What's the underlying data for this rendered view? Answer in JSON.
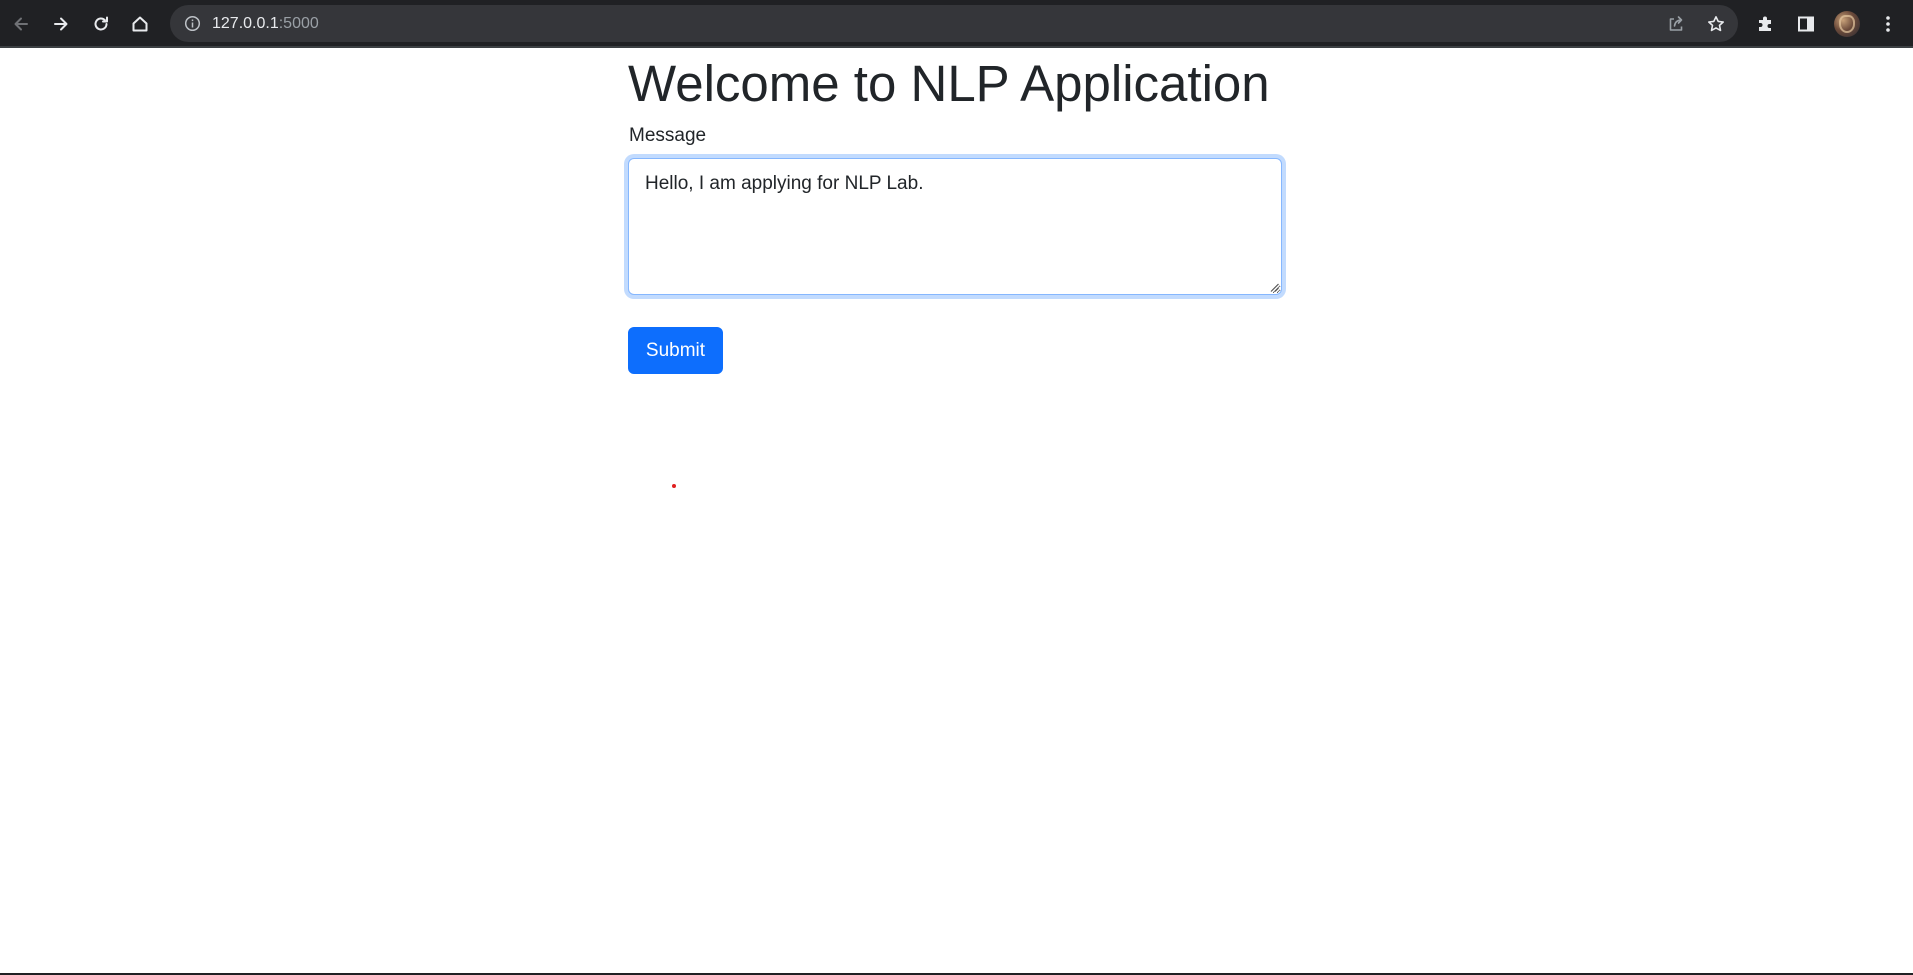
{
  "browser": {
    "url_host": "127.0.0.1",
    "url_port": ":5000",
    "icons": {
      "back": "back-arrow-icon",
      "forward": "forward-arrow-icon",
      "reload": "reload-icon",
      "home": "home-icon",
      "site_info": "info-icon",
      "share": "share-icon",
      "bookmark": "star-icon",
      "extensions": "puzzle-icon",
      "side_panel": "side-panel-icon",
      "profile": "avatar",
      "menu": "kebab-menu-icon"
    },
    "colors": {
      "toolbar_bg": "#202124",
      "omnibox_bg": "#35363a"
    }
  },
  "page": {
    "title": "Welcome to NLP Application",
    "form": {
      "message_label": "Message",
      "message_value": "Hello, I am applying for NLP Lab.",
      "submit_label": "Submit"
    },
    "colors": {
      "primary": "#0d6efd",
      "text": "#212529",
      "focus_ring": "#86b7fe"
    }
  }
}
